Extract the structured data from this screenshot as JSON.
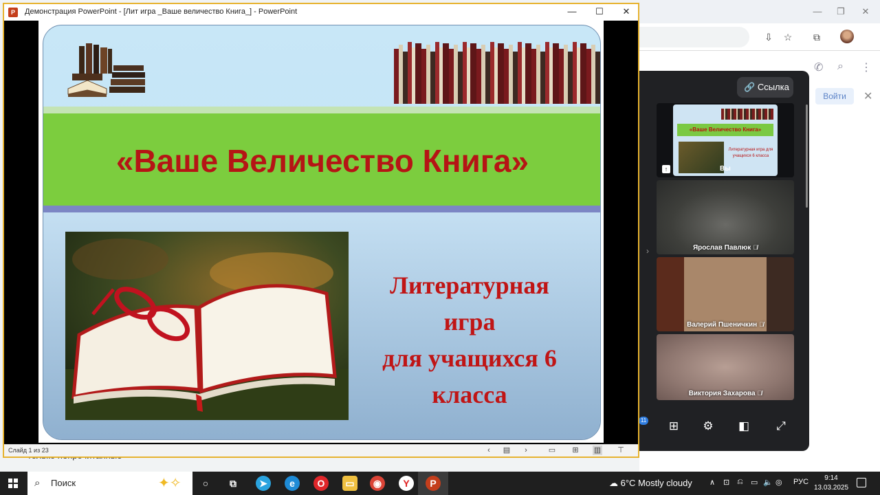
{
  "ppt": {
    "window_title": "Демонстрация PowerPoint - [Лит игра _Ваше величество Книга_] - PowerPoint",
    "slide_counter": "Слайд 1 из 23",
    "slide": {
      "title": "«Ваше Величество Книга»",
      "subtitle_lines": [
        "Литературная",
        "игра",
        "для учащихся 6",
        "класса"
      ]
    }
  },
  "call": {
    "link_button": "Ссылка",
    "you_label": "Вы",
    "mini_title": "«Ваше Величество Книга»",
    "mini_text": "Литературная игра для учащихся 6 класса",
    "participants": [
      "Ярослав Павлюк",
      "Валерий Пшеничкин",
      "Виктория Захарова"
    ],
    "notification_count": "11"
  },
  "browser": {
    "login_button": "Войти",
    "under_text": "только непрочитанные"
  },
  "taskbar": {
    "search_placeholder": "Поиск",
    "weather": "6°C  Mostly cloudy",
    "language": "РУС",
    "time": "9:14",
    "date": "13.03.2025"
  }
}
